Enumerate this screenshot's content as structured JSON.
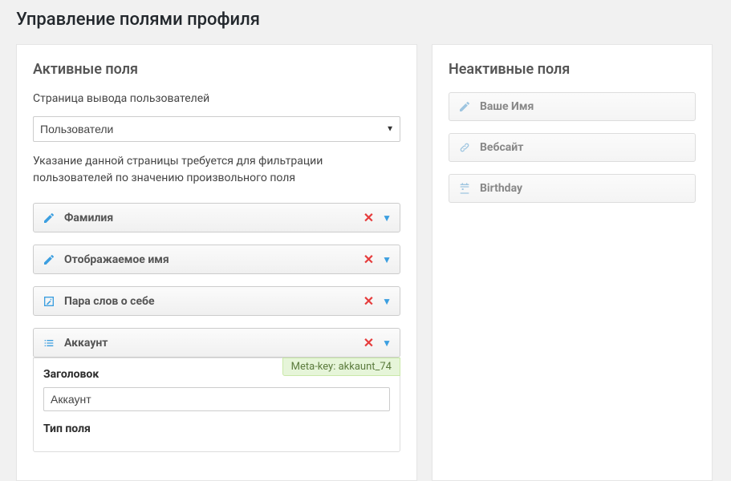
{
  "page": {
    "title": "Управление полями профиля"
  },
  "active": {
    "heading": "Активные поля",
    "page_output_label": "Страница вывода пользователей",
    "page_output_value": "Пользователи",
    "help_text": "Указание данной страницы требуется для фильтрации пользователей по значению произвольного поля",
    "fields": [
      {
        "label": "Фамилия",
        "icon": "pencil"
      },
      {
        "label": "Отображаемое имя",
        "icon": "pencil"
      },
      {
        "label": "Пара слов о себе",
        "icon": "edit-box"
      },
      {
        "label": "Аккаунт",
        "icon": "list"
      }
    ],
    "expanded": {
      "meta_key_label": "Meta-key:",
      "meta_key_value": "akkaunt_74",
      "title_label": "Заголовок",
      "title_value": "Аккаунт",
      "type_label": "Тип поля"
    }
  },
  "inactive": {
    "heading": "Неактивные поля",
    "fields": [
      {
        "label": "Ваше Имя",
        "icon": "pencil"
      },
      {
        "label": "Вебсайт",
        "icon": "link"
      },
      {
        "label": "Birthday",
        "icon": "calendar"
      }
    ]
  }
}
